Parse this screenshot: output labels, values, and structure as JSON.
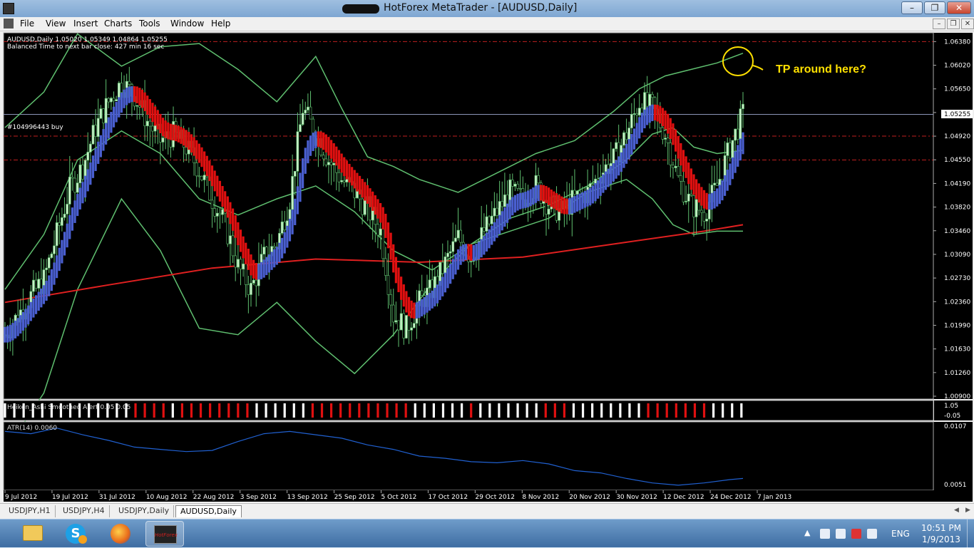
{
  "window": {
    "title": "HotForex MetaTrader - [AUDUSD,Daily]",
    "minimize": "–",
    "restore": "❐",
    "close": "✕"
  },
  "menu": {
    "items": [
      "File",
      "View",
      "Insert",
      "Charts",
      "Tools",
      "Window",
      "Help"
    ]
  },
  "mdi": {
    "minimize": "–",
    "restore": "❐",
    "close": "✕"
  },
  "chart": {
    "info_line1": "AUDUSD,Daily  1.05020 1.05349 1.04864 1.05255",
    "info_line2": "Balanced Time to next bar close: 427 min 16 sec",
    "order_label": "#104996443 buy",
    "annotation": "TP around here?",
    "current_price": "1.05255",
    "heiken_label": "Heiken_Ashi Smoothed Alert 0.05 0.05",
    "heiken_scale_top": "1.05",
    "heiken_scale_bottom": "-0.05",
    "atr_label": "ATR(14) 0.0060",
    "atr_scale_top": "0.0107",
    "atr_scale_bottom": "0.0051",
    "colors": {
      "background": "#000000",
      "bollinger": "#5fbf6f",
      "ma": "#e02020",
      "bull_ha": "#4a5fd0",
      "bear_ha": "#e01010",
      "candle": "#c8f0c8",
      "atr": "#2060d0",
      "annotation": "#ffe000",
      "order_line": "#c02020"
    }
  },
  "chart_data": {
    "type": "line",
    "title": "AUDUSD,Daily",
    "x_labels": [
      "9 Jul 2012",
      "19 Jul 2012",
      "31 Jul 2012",
      "10 Aug 2012",
      "22 Aug 2012",
      "3 Sep 2012",
      "13 Sep 2012",
      "25 Sep 2012",
      "5 Oct 2012",
      "17 Oct 2012",
      "29 Oct 2012",
      "8 Nov 2012",
      "20 Nov 2012",
      "30 Nov 2012",
      "12 Dec 2012",
      "24 Dec 2012",
      "7 Jan 2013"
    ],
    "y_labels": [
      "1.06380",
      "1.06020",
      "1.05650",
      "1.05255",
      "1.04920",
      "1.04550",
      "1.04190",
      "1.03820",
      "1.03460",
      "1.03090",
      "1.02730",
      "1.02360",
      "1.01990",
      "1.01630",
      "1.01260",
      "1.00900"
    ],
    "ylim": [
      1.009,
      1.0645
    ],
    "series": [
      {
        "name": "Close",
        "x": [
          0,
          5,
          10,
          15,
          20,
          25,
          30,
          35,
          40,
          45,
          50,
          55,
          60,
          65,
          70,
          75,
          80,
          85,
          90,
          95,
          100,
          105,
          110,
          115,
          120,
          125,
          130,
          135,
          140,
          145,
          150,
          155,
          160,
          165,
          170,
          175,
          180,
          185,
          190,
          195,
          200,
          205,
          210,
          215,
          220,
          225,
          230,
          235,
          240,
          245,
          250,
          255,
          260,
          265,
          270,
          275,
          280,
          285
        ],
        "values": [
          1.0185,
          1.0215,
          1.0245,
          1.027,
          1.034,
          1.041,
          1.0445,
          1.0505,
          1.0545,
          1.0575,
          1.0555,
          1.0515,
          1.0485,
          1.0495,
          1.0475,
          1.044,
          1.0395,
          1.0355,
          1.029,
          1.0255,
          1.0305,
          1.0325,
          1.0395,
          1.0535,
          1.0495,
          1.0455,
          1.0425,
          1.0405,
          1.038,
          1.0345,
          1.0215,
          1.0195,
          1.0235,
          1.0255,
          1.0295,
          1.0335,
          1.0305,
          1.0345,
          1.0375,
          1.0405,
          1.0395,
          1.0415,
          1.0385,
          1.0375,
          1.0395,
          1.0405,
          1.0435,
          1.0455,
          1.0495,
          1.0545,
          1.0535,
          1.0495,
          1.0425,
          1.0385,
          1.0375,
          1.0415,
          1.0475,
          1.0525
        ]
      },
      {
        "name": "MA",
        "x": [
          0,
          40,
          80,
          120,
          160,
          200,
          240,
          270,
          285
        ],
        "values": [
          1.0235,
          1.0262,
          1.0288,
          1.0302,
          1.0297,
          1.0305,
          1.0328,
          1.0345,
          1.0355
        ]
      },
      {
        "name": "BB upper",
        "x": [
          0,
          15,
          28,
          45,
          60,
          75,
          90,
          105,
          120,
          130,
          140,
          150,
          160,
          175,
          190,
          205,
          220,
          235,
          245,
          255,
          265,
          275,
          285
        ],
        "values": [
          1.0505,
          1.056,
          1.065,
          1.06,
          1.063,
          1.0635,
          1.0595,
          1.0545,
          1.0615,
          1.0535,
          1.046,
          1.0445,
          1.0425,
          1.0405,
          1.0435,
          1.0465,
          1.0485,
          1.053,
          1.0565,
          1.0585,
          1.0595,
          1.0605,
          1.062
        ]
      },
      {
        "name": "BB middle",
        "x": [
          0,
          15,
          28,
          45,
          60,
          75,
          90,
          105,
          120,
          135,
          150,
          165,
          180,
          195,
          210,
          225,
          240,
          250,
          258,
          266,
          275,
          285
        ],
        "values": [
          1.0255,
          1.034,
          1.0455,
          1.05,
          1.0465,
          1.0395,
          1.037,
          1.0395,
          1.0415,
          1.0375,
          1.0315,
          1.0285,
          1.0325,
          1.0365,
          1.0385,
          1.0415,
          1.0455,
          1.0495,
          1.0505,
          1.0475,
          1.0465,
          1.047
        ]
      },
      {
        "name": "BB lower",
        "x": [
          0,
          15,
          28,
          45,
          60,
          75,
          90,
          105,
          120,
          135,
          150,
          165,
          180,
          195,
          210,
          225,
          240,
          250,
          258,
          266,
          275,
          285
        ],
        "values": [
          1.0005,
          1.0095,
          1.0255,
          1.0395,
          1.0315,
          1.0195,
          1.0185,
          1.0235,
          1.0175,
          1.0125,
          1.0185,
          1.0265,
          1.0325,
          1.0345,
          1.0365,
          1.0405,
          1.0425,
          1.0395,
          1.0355,
          1.034,
          1.0345,
          1.0345
        ]
      }
    ],
    "atr": {
      "x": [
        0,
        10,
        20,
        30,
        40,
        50,
        60,
        70,
        80,
        90,
        100,
        110,
        120,
        130,
        140,
        150,
        160,
        170,
        180,
        190,
        200,
        210,
        220,
        230,
        240,
        250,
        260,
        270,
        280,
        285
      ],
      "values": [
        0.0101,
        0.0099,
        0.0104,
        0.0098,
        0.0093,
        0.0087,
        0.0085,
        0.0083,
        0.0084,
        0.0092,
        0.0099,
        0.0101,
        0.0098,
        0.0095,
        0.0089,
        0.0085,
        0.0079,
        0.0077,
        0.0074,
        0.0073,
        0.0075,
        0.0072,
        0.0066,
        0.0064,
        0.0059,
        0.0055,
        0.0053,
        0.0055,
        0.0058,
        0.0059
      ]
    },
    "order_levels": [
      1.0638,
      1.0492,
      1.0455
    ],
    "current_price": 1.05255
  },
  "tabs": [
    "USDJPY,H1",
    "USDJPY,H4",
    "USDJPY,Daily",
    "AUDUSD,Daily"
  ],
  "tab_scroll": {
    "left": "◀",
    "right": "▶"
  },
  "taskbar": {
    "skype_letter": "S",
    "mt_label": "HotForex",
    "tray_arrow": "▲",
    "lang": "ENG",
    "time": "10:51 PM",
    "date": "1/9/2013"
  }
}
